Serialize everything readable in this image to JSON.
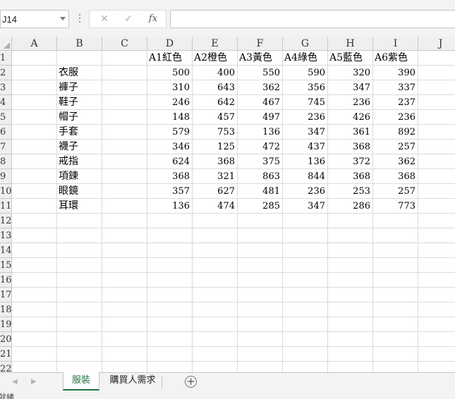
{
  "formula_bar": {
    "name_box": "J14",
    "cancel_icon": "✕",
    "enter_icon": "✓",
    "fx_label": "fx",
    "formula": ""
  },
  "columns": [
    "A",
    "B",
    "C",
    "D",
    "E",
    "F",
    "G",
    "H",
    "I",
    "J"
  ],
  "rows": [
    "1",
    "2",
    "3",
    "4",
    "5",
    "6",
    "7",
    "8",
    "9",
    "10",
    "11",
    "12",
    "13",
    "14",
    "15",
    "16",
    "17",
    "18",
    "19",
    "20",
    "21",
    "22"
  ],
  "table": {
    "headers": [
      "A1紅色",
      "A2橙色",
      "A3黃色",
      "A4綠色",
      "A5藍色",
      "A6紫色"
    ],
    "items": [
      {
        "name": "衣服",
        "values": [
          "500",
          "400",
          "550",
          "590",
          "320",
          "390"
        ]
      },
      {
        "name": "褲子",
        "values": [
          "310",
          "643",
          "362",
          "356",
          "347",
          "337"
        ]
      },
      {
        "name": "鞋子",
        "values": [
          "246",
          "642",
          "467",
          "745",
          "236",
          "237"
        ]
      },
      {
        "name": "帽子",
        "values": [
          "148",
          "457",
          "497",
          "236",
          "426",
          "236"
        ]
      },
      {
        "name": "手套",
        "values": [
          "579",
          "753",
          "136",
          "347",
          "361",
          "892"
        ]
      },
      {
        "name": "襪子",
        "values": [
          "346",
          "125",
          "472",
          "437",
          "368",
          "257"
        ]
      },
      {
        "name": "戒指",
        "values": [
          "624",
          "368",
          "375",
          "136",
          "372",
          "362"
        ]
      },
      {
        "name": "項鍊",
        "values": [
          "368",
          "321",
          "863",
          "844",
          "368",
          "368"
        ]
      },
      {
        "name": "眼鏡",
        "values": [
          "357",
          "627",
          "481",
          "236",
          "253",
          "257"
        ]
      },
      {
        "name": "耳環",
        "values": [
          "136",
          "474",
          "285",
          "347",
          "286",
          "773"
        ]
      }
    ]
  },
  "sheet_tabs": {
    "prev": "◀",
    "next": "▶",
    "tabs": [
      {
        "label": "服裝",
        "active": true
      },
      {
        "label": "購買人需求",
        "active": false
      }
    ],
    "add": "+"
  },
  "status_text": "就緒",
  "colors": {
    "accent": "#217346"
  }
}
